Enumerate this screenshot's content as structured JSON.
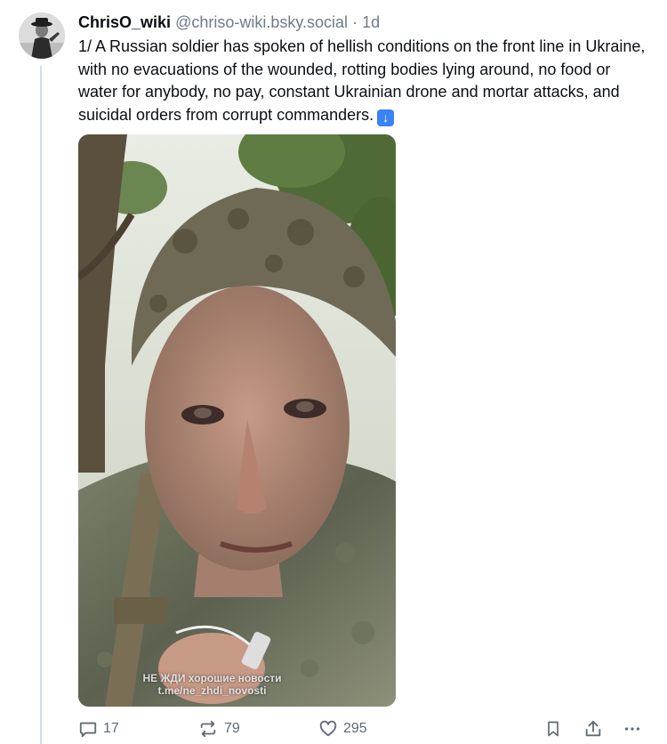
{
  "post": {
    "display_name": "ChrisO_wiki",
    "handle": "@chriso-wiki.bsky.social",
    "separator": "·",
    "age": "1d",
    "text": "1/ A Russian soldier has spoken of hellish conditions on the front line in Ukraine, with no evacuations of the wounded, rotting bodies lying around, no food or water for anybody, no pay, constant Ukrainian drone and mortar attacks, and suicidal orders from corrupt commanders.",
    "emoji_icon": "down-arrow-emoji-icon",
    "media_watermark_line1": "НЕ ЖДИ хорошие новости",
    "media_watermark_line2": "t.me/ne_zhdi_novosti"
  },
  "actions": {
    "reply_count": "17",
    "repost_count": "79",
    "like_count": "295",
    "icons": [
      "reply-icon",
      "repost-icon",
      "like-icon",
      "bookmark-icon",
      "share-icon",
      "more-icon"
    ]
  },
  "colors": {
    "text": "#0b0f14",
    "muted": "#6f7b88",
    "thread_line": "#d4dbe2",
    "emoji_blue": "#3b82f6"
  }
}
